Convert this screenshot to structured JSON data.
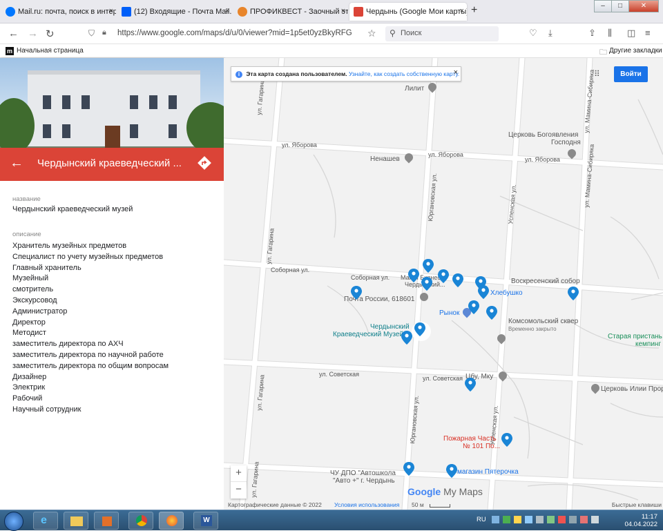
{
  "browser": {
    "tabs": [
      {
        "label": "Mail.ru: почта, поиск в интерн",
        "favicon_color": "#0077ff"
      },
      {
        "label": "(12) Входящие - Почта Mail.ru",
        "favicon_color": "#005ff9"
      },
      {
        "label": "ПРОФИКВЕСТ - Заочный этап",
        "favicon_color": "#e8852b"
      },
      {
        "label": "Чердынь (Google Мои карты)",
        "favicon_color": "#db4437"
      }
    ],
    "tab_close_glyph": "×",
    "new_tab_glyph": "+",
    "url": "https://www.google.com/maps/d/u/0/viewer?mid=1p5et0yzBkyRFGbJqBKM4",
    "search_placeholder": "Поиск",
    "bookmark_home": "Начальная страница",
    "bookmark_other": "Другие закладки"
  },
  "sidebar": {
    "title": "Чердынский краеведческий ...",
    "name_label": "название",
    "name_value": "Чердынский краеведческий музей",
    "desc_label": "описание",
    "description_lines": [
      "Хранитель музейных предметов",
      "Специалист по учету музейных предметов",
      "Главный хранитель",
      "Музейный",
      "смотритель",
      "Экскурсовод",
      "Администратор",
      "Директор",
      "Методист",
      "заместитель директора по АХЧ",
      "заместитель директора по научной работе",
      "заместитель директора по общим вопросам",
      "Дизайнер",
      "Электрик",
      "Рабочий",
      "Научный сотрудник"
    ]
  },
  "map": {
    "info_text": "Эта карта создана пользователем.",
    "info_link": "Узнайте, как создать собственную карту.",
    "info_close": "×",
    "signin_label": "Войти",
    "zoom_in": "+",
    "zoom_out": "−",
    "streets": {
      "yaborova_1": "ул. Яборова",
      "yaborova_2": "ул. Яборова",
      "yaborova_3": "ул. Яборова",
      "sobornaya_1": "Соборная ул.",
      "sobornaya_2": "Соборная ул.",
      "sovetskaya_1": "ул. Советская",
      "sovetskaya_2": "ул. Советская",
      "gagarina_1": "ул. Гагарина",
      "gagarina_2": "ул. Гагарина",
      "gagarina_3": "ул. Гагарина",
      "gagarina_4": "ул. Гагарина",
      "yurganovskaya_1": "Юргановская ул.",
      "yurganovskaya_2": "Юргановская ул.",
      "uspenskaya_1": "Успенская ул.",
      "uspenskaya_2": "Успенская ул.",
      "mamina_1": "ул. Мамина-Сибиряка",
      "mamina_2": "ул. Мамина-Сибиряка"
    },
    "places": {
      "lilit": "Лилит",
      "church_epiphany_1": "Церковь Богоявления",
      "church_epiphany_2": "Господня",
      "nenashev": "Ненашев",
      "voskresensky": "Воскресенский собор",
      "khlebushko": "Хлебушко",
      "magic": "Магия Бизнес",
      "cherdyn_short": "Чердынский...",
      "post": "Почта России, 618601",
      "market": "Рынок",
      "komsomol": "Комсомольский сквер",
      "komsomol_status": "Временно закрыто",
      "museum_1": "Чердынский",
      "museum_2": "Краеведческий Музей",
      "pier_1": "Старая пристань",
      "pier_2": "кемпинг",
      "cbu": "Цбу, Мку",
      "church_ilia": "Церковь Илии Пророка",
      "fire_1": "Пожарная Часть",
      "fire_2": "№ 101 По...",
      "driving_1": "ЧУ ДПО \"Автошкола",
      "driving_2": "\"Авто +\" г. Чердынь",
      "pyaterochka": "магазин Пятерочка"
    },
    "logo_google": "Google",
    "logo_mymaps": "My Maps",
    "copyright": "Картографические данные © 2022",
    "terms": "Условия использования",
    "scale": "50 м",
    "shortcuts": "Быстрые клавиши",
    "pin_color": "#1a85d6",
    "selected_pin_color": "#1a85d6"
  },
  "taskbar": {
    "lang": "RU",
    "time": "11:17",
    "date": "04.04.2022"
  }
}
